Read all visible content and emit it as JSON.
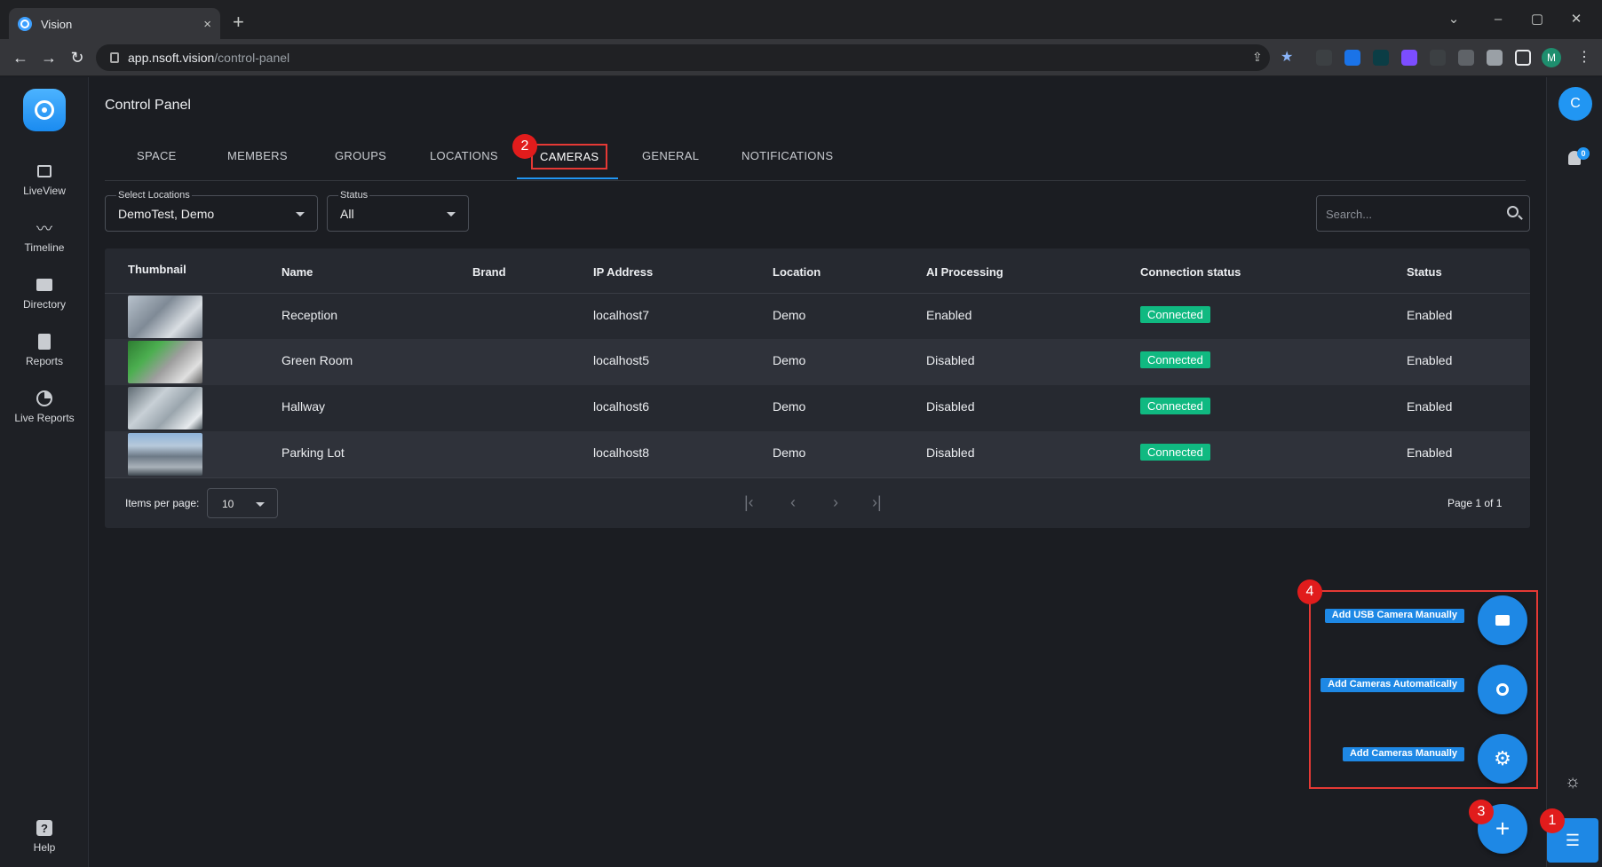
{
  "browser": {
    "tab_title": "Vision",
    "tab_close": "×",
    "new_tab": "+",
    "url_host": "app.nsoft.vision",
    "url_path": "/control-panel",
    "win_min": "–",
    "win_max": "▢",
    "win_close": "✕",
    "back": "←",
    "forward": "→",
    "reload": "↻",
    "profile": "M"
  },
  "sidebar": {
    "items": [
      {
        "label": "LiveView",
        "icon": "tv-icon"
      },
      {
        "label": "Timeline",
        "icon": "trend-icon"
      },
      {
        "label": "Directory",
        "icon": "folder-icon"
      },
      {
        "label": "Reports",
        "icon": "document-icon"
      },
      {
        "label": "Live Reports",
        "icon": "pie-icon"
      }
    ],
    "help_label": "Help"
  },
  "header": {
    "title": "Control Panel",
    "user_initial": "C",
    "notification_count": "0"
  },
  "tabs": [
    "SPACE",
    "MEMBERS",
    "GROUPS",
    "LOCATIONS",
    "CAMERAS",
    "GENERAL",
    "NOTIFICATIONS"
  ],
  "filters": {
    "locations_label": "Select Locations",
    "locations_value": "DemoTest, Demo",
    "status_label": "Status",
    "status_value": "All",
    "search_placeholder": "Search..."
  },
  "table": {
    "columns": [
      "Thumbnail",
      "Name",
      "Brand",
      "IP Address",
      "Location",
      "AI Processing",
      "Connection status",
      "Status"
    ],
    "rows": [
      {
        "name": "Reception",
        "brand": "",
        "ip": "localhost7",
        "location": "Demo",
        "ai": "Enabled",
        "connection": "Connected",
        "status": "Enabled"
      },
      {
        "name": "Green Room",
        "brand": "",
        "ip": "localhost5",
        "location": "Demo",
        "ai": "Disabled",
        "connection": "Connected",
        "status": "Enabled"
      },
      {
        "name": "Hallway",
        "brand": "",
        "ip": "localhost6",
        "location": "Demo",
        "ai": "Disabled",
        "connection": "Connected",
        "status": "Enabled"
      },
      {
        "name": "Parking Lot",
        "brand": "",
        "ip": "localhost8",
        "location": "Demo",
        "ai": "Disabled",
        "connection": "Connected",
        "status": "Enabled"
      }
    ]
  },
  "pagination": {
    "items_per_page_label": "Items per page:",
    "items_per_page_value": "10",
    "page_info": "Page 1 of 1",
    "first": "|‹",
    "prev": "‹",
    "next": "›",
    "last": "›|"
  },
  "fab_menu": {
    "usb_label": "Add USB Camera Manually",
    "auto_label": "Add Cameras Automatically",
    "manual_label": "Add Cameras Manually",
    "main_symbol": "+"
  },
  "markers": [
    "1",
    "2",
    "3",
    "4"
  ],
  "colors": {
    "accent": "#1e88e5",
    "connected": "#10b981",
    "annotation": "#e53935"
  }
}
